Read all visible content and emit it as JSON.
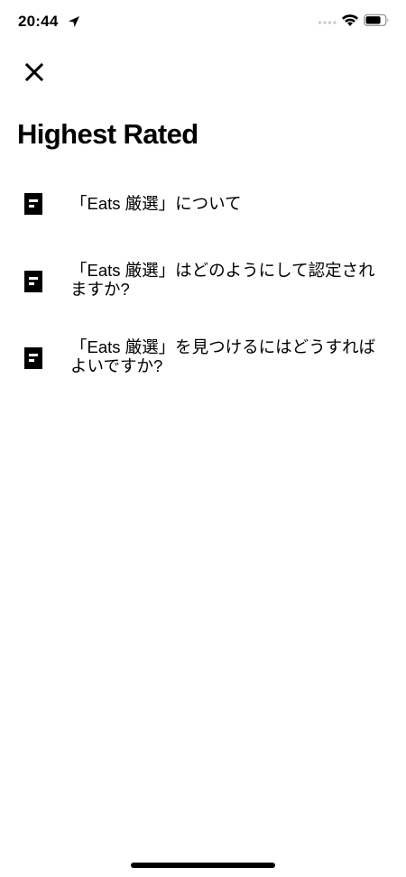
{
  "status_bar": {
    "time": "20:44"
  },
  "header": {
    "close_icon": "close-icon",
    "title": "Highest Rated"
  },
  "articles": [
    {
      "icon": "document-icon",
      "label": "「Eats 厳選」について"
    },
    {
      "icon": "document-icon",
      "label": "「Eats 厳選」はどのようにして認定されますか?"
    },
    {
      "icon": "document-icon",
      "label": "「Eats 厳選」を見つけるにはどうすればよいですか?"
    }
  ],
  "colors": {
    "text": "#000000",
    "background": "#ffffff",
    "status_inactive": "#c7c7cc"
  }
}
